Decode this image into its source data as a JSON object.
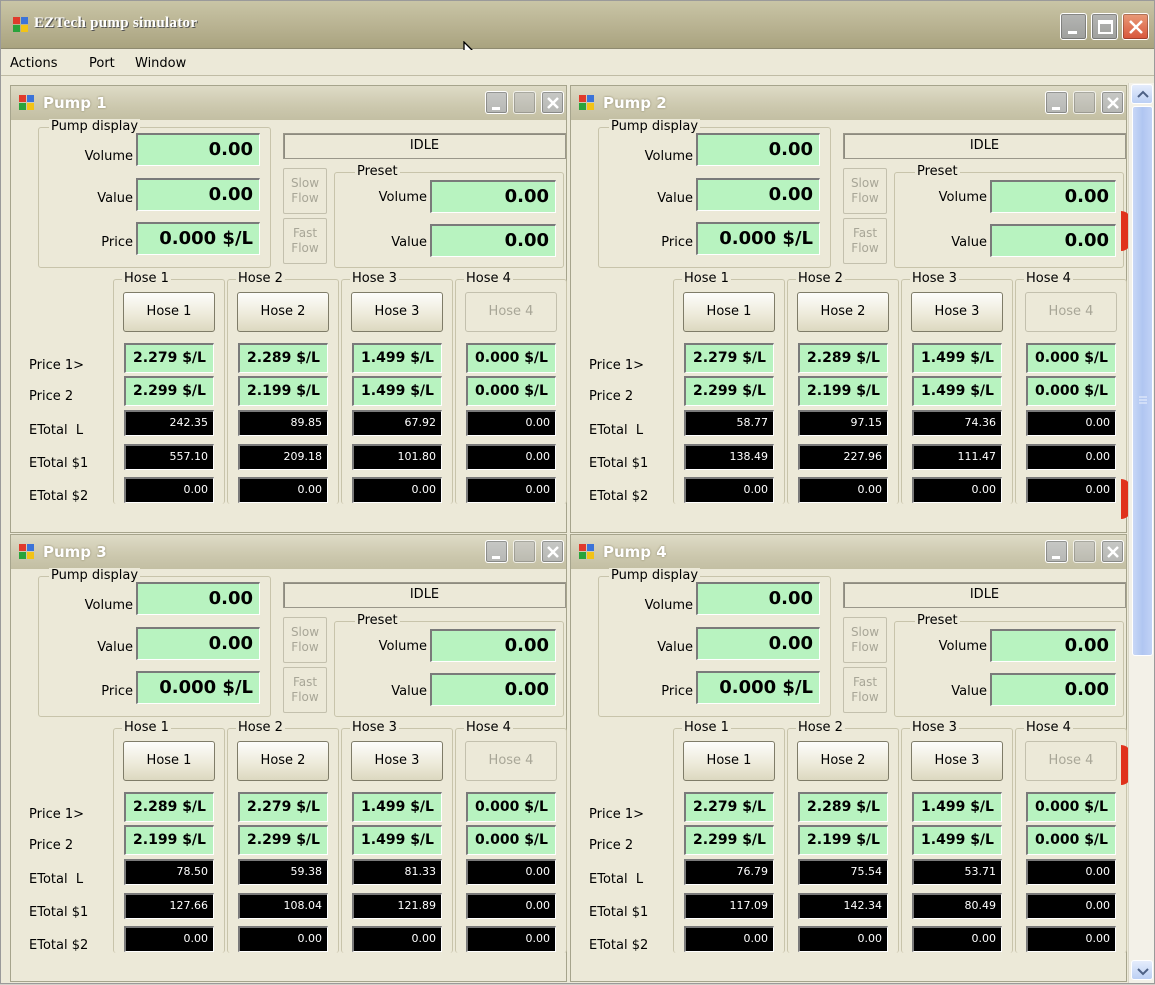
{
  "window": {
    "title": "EZTech pump simulator"
  },
  "menu": [
    "Actions",
    "Port",
    "Window"
  ],
  "pumps": [
    {
      "title": "Pump 1",
      "display_label": "Pump display",
      "volume_label": "Volume",
      "value_label": "Value",
      "price_label": "Price",
      "volume": "0.00",
      "value": "0.00",
      "price": "0.000 $/L",
      "status": "IDLE",
      "slow_flow": "Slow\nFlow",
      "fast_flow": "Fast\nFlow",
      "preset_label": "Preset",
      "preset_volume": "0.00",
      "preset_value": "0.00",
      "row_labels": [
        "Price 1>",
        "Price 2",
        "ETotal  L",
        "ETotal $1",
        "ETotal $2"
      ],
      "hoses": [
        {
          "group": "Hose 1",
          "button": "Hose 1",
          "enabled": true,
          "price1": "2.279 $/L",
          "price2": "2.299 $/L",
          "etotal_l": "242.35",
          "etotal_1": "557.10",
          "etotal_2": "0.00"
        },
        {
          "group": "Hose 2",
          "button": "Hose 2",
          "enabled": true,
          "price1": "2.289 $/L",
          "price2": "2.199 $/L",
          "etotal_l": "89.85",
          "etotal_1": "209.18",
          "etotal_2": "0.00"
        },
        {
          "group": "Hose 3",
          "button": "Hose 3",
          "enabled": true,
          "price1": "1.499 $/L",
          "price2": "1.499 $/L",
          "etotal_l": "67.92",
          "etotal_1": "101.80",
          "etotal_2": "0.00"
        },
        {
          "group": "Hose 4",
          "button": "Hose 4",
          "enabled": false,
          "price1": "0.000 $/L",
          "price2": "0.000 $/L",
          "etotal_l": "0.00",
          "etotal_1": "0.00",
          "etotal_2": "0.00"
        }
      ]
    },
    {
      "title": "Pump 2",
      "display_label": "Pump display",
      "volume_label": "Volume",
      "value_label": "Value",
      "price_label": "Price",
      "volume": "0.00",
      "value": "0.00",
      "price": "0.000 $/L",
      "status": "IDLE",
      "slow_flow": "Slow\nFlow",
      "fast_flow": "Fast\nFlow",
      "preset_label": "Preset",
      "preset_volume": "0.00",
      "preset_value": "0.00",
      "row_labels": [
        "Price 1>",
        "Price 2",
        "ETotal  L",
        "ETotal $1",
        "ETotal $2"
      ],
      "hoses": [
        {
          "group": "Hose 1",
          "button": "Hose 1",
          "enabled": true,
          "price1": "2.279 $/L",
          "price2": "2.299 $/L",
          "etotal_l": "58.77",
          "etotal_1": "138.49",
          "etotal_2": "0.00"
        },
        {
          "group": "Hose 2",
          "button": "Hose 2",
          "enabled": true,
          "price1": "2.289 $/L",
          "price2": "2.199 $/L",
          "etotal_l": "97.15",
          "etotal_1": "227.96",
          "etotal_2": "0.00"
        },
        {
          "group": "Hose 3",
          "button": "Hose 3",
          "enabled": true,
          "price1": "1.499 $/L",
          "price2": "1.499 $/L",
          "etotal_l": "74.36",
          "etotal_1": "111.47",
          "etotal_2": "0.00"
        },
        {
          "group": "Hose 4",
          "button": "Hose 4",
          "enabled": false,
          "price1": "0.000 $/L",
          "price2": "0.000 $/L",
          "etotal_l": "0.00",
          "etotal_1": "0.00",
          "etotal_2": "0.00"
        }
      ]
    },
    {
      "title": "Pump 3",
      "display_label": "Pump display",
      "volume_label": "Volume",
      "value_label": "Value",
      "price_label": "Price",
      "volume": "0.00",
      "value": "0.00",
      "price": "0.000 $/L",
      "status": "IDLE",
      "slow_flow": "Slow\nFlow",
      "fast_flow": "Fast\nFlow",
      "preset_label": "Preset",
      "preset_volume": "0.00",
      "preset_value": "0.00",
      "row_labels": [
        "Price 1>",
        "Price 2",
        "ETotal  L",
        "ETotal $1",
        "ETotal $2"
      ],
      "hoses": [
        {
          "group": "Hose 1",
          "button": "Hose 1",
          "enabled": true,
          "price1": "2.289 $/L",
          "price2": "2.199 $/L",
          "etotal_l": "78.50",
          "etotal_1": "127.66",
          "etotal_2": "0.00"
        },
        {
          "group": "Hose 2",
          "button": "Hose 2",
          "enabled": true,
          "price1": "2.279 $/L",
          "price2": "2.299 $/L",
          "etotal_l": "59.38",
          "etotal_1": "108.04",
          "etotal_2": "0.00"
        },
        {
          "group": "Hose 3",
          "button": "Hose 3",
          "enabled": true,
          "price1": "1.499 $/L",
          "price2": "1.499 $/L",
          "etotal_l": "81.33",
          "etotal_1": "121.89",
          "etotal_2": "0.00"
        },
        {
          "group": "Hose 4",
          "button": "Hose 4",
          "enabled": false,
          "price1": "0.000 $/L",
          "price2": "0.000 $/L",
          "etotal_l": "0.00",
          "etotal_1": "0.00",
          "etotal_2": "0.00"
        }
      ]
    },
    {
      "title": "Pump 4",
      "display_label": "Pump display",
      "volume_label": "Volume",
      "value_label": "Value",
      "price_label": "Price",
      "volume": "0.00",
      "value": "0.00",
      "price": "0.000 $/L",
      "status": "IDLE",
      "slow_flow": "Slow\nFlow",
      "fast_flow": "Fast\nFlow",
      "preset_label": "Preset",
      "preset_volume": "0.00",
      "preset_value": "0.00",
      "row_labels": [
        "Price 1>",
        "Price 2",
        "ETotal  L",
        "ETotal $1",
        "ETotal $2"
      ],
      "hoses": [
        {
          "group": "Hose 1",
          "button": "Hose 1",
          "enabled": true,
          "price1": "2.279 $/L",
          "price2": "2.299 $/L",
          "etotal_l": "76.79",
          "etotal_1": "117.09",
          "etotal_2": "0.00"
        },
        {
          "group": "Hose 2",
          "button": "Hose 2",
          "enabled": true,
          "price1": "2.289 $/L",
          "price2": "2.199 $/L",
          "etotal_l": "75.54",
          "etotal_1": "142.34",
          "etotal_2": "0.00"
        },
        {
          "group": "Hose 3",
          "button": "Hose 3",
          "enabled": true,
          "price1": "1.499 $/L",
          "price2": "1.499 $/L",
          "etotal_l": "53.71",
          "etotal_1": "80.49",
          "etotal_2": "0.00"
        },
        {
          "group": "Hose 4",
          "button": "Hose 4",
          "enabled": false,
          "price1": "0.000 $/L",
          "price2": "0.000 $/L",
          "etotal_l": "0.00",
          "etotal_1": "0.00",
          "etotal_2": "0.00"
        }
      ]
    }
  ],
  "icons": {
    "app": "app-window-icon",
    "minimize": "minimize-icon",
    "maximize": "maximize-icon",
    "close": "close-icon",
    "scroll_up": "scroll-up-arrow-icon",
    "scroll_down": "scroll-down-arrow-icon",
    "cursor": "mouse-cursor-icon"
  },
  "colors": {
    "display_green": "#b8f3c0",
    "total_black": "#000000",
    "close_red": "#d8553a"
  }
}
